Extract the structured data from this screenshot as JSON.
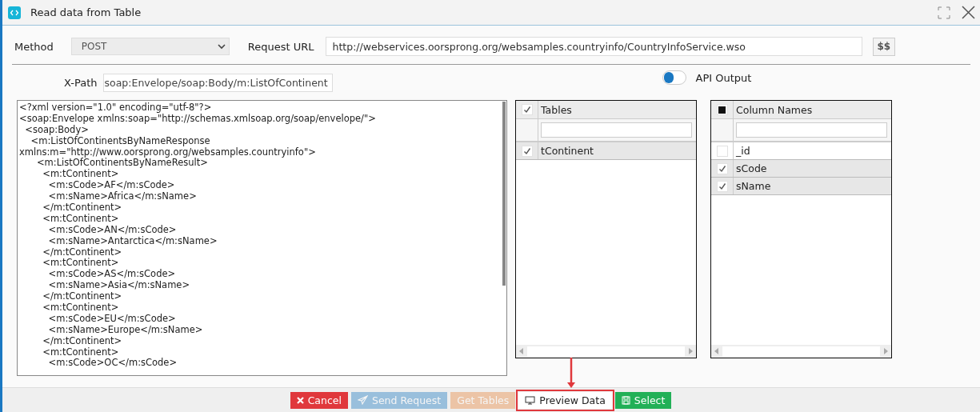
{
  "window": {
    "title": "Read data from Table"
  },
  "method": {
    "label": "Method",
    "value": "POST"
  },
  "request_url": {
    "label": "Request URL",
    "value": "http://webservices.oorsprong.org/websamples.countryinfo/CountryInfoService.wso",
    "button": "$$"
  },
  "xpath": {
    "label": "X-Path",
    "value": "soap:Envelope/soap:Body/m:ListOfContinent"
  },
  "api_output": {
    "label": "API Output",
    "on": false
  },
  "response_lines": [
    "<?xml version=\"1.0\" encoding=\"utf-8\"?>",
    "<soap:Envelope xmlns:soap=\"http://schemas.xmlsoap.org/soap/envelope/\">",
    "  <soap:Body>",
    "    <m:ListOfContinentsByNameResponse",
    "xmlns:m=\"http://www.oorsprong.org/websamples.countryinfo\">",
    "      <m:ListOfContinentsByNameResult>",
    "        <m:tContinent>",
    "          <m:sCode>AF</m:sCode>",
    "          <m:sName>Africa</m:sName>",
    "        </m:tContinent>",
    "        <m:tContinent>",
    "          <m:sCode>AN</m:sCode>",
    "          <m:sName>Antarctica</m:sName>",
    "        </m:tContinent>",
    "        <m:tContinent>",
    "          <m:sCode>AS</m:sCode>",
    "          <m:sName>Asia</m:sName>",
    "        </m:tContinent>",
    "        <m:tContinent>",
    "          <m:sCode>EU</m:sCode>",
    "          <m:sName>Europe</m:sName>",
    "        </m:tContinent>",
    "        <m:tContinent>",
    "          <m:sCode>OC</m:sCode>"
  ],
  "tables": {
    "header": "Tables",
    "all_checked": true,
    "rows": [
      {
        "name": "tContinent",
        "checked": true
      }
    ]
  },
  "columns": {
    "header": "Column Names",
    "all_checked": false,
    "some_checked": true,
    "rows": [
      {
        "name": "_id",
        "checked": false
      },
      {
        "name": "sCode",
        "checked": true
      },
      {
        "name": "sName",
        "checked": true
      }
    ]
  },
  "buttons": [
    {
      "label": "Cancel",
      "kind": "cancel",
      "disabled": false,
      "highlighted": false
    },
    {
      "label": "Send Request",
      "kind": "send",
      "disabled": true,
      "highlighted": false
    },
    {
      "label": "Get Tables",
      "kind": "tables",
      "disabled": true,
      "highlighted": false
    },
    {
      "label": "Preview Data",
      "kind": "preview",
      "disabled": false,
      "highlighted": true
    },
    {
      "label": "Select",
      "kind": "select",
      "disabled": false,
      "highlighted": false
    }
  ]
}
